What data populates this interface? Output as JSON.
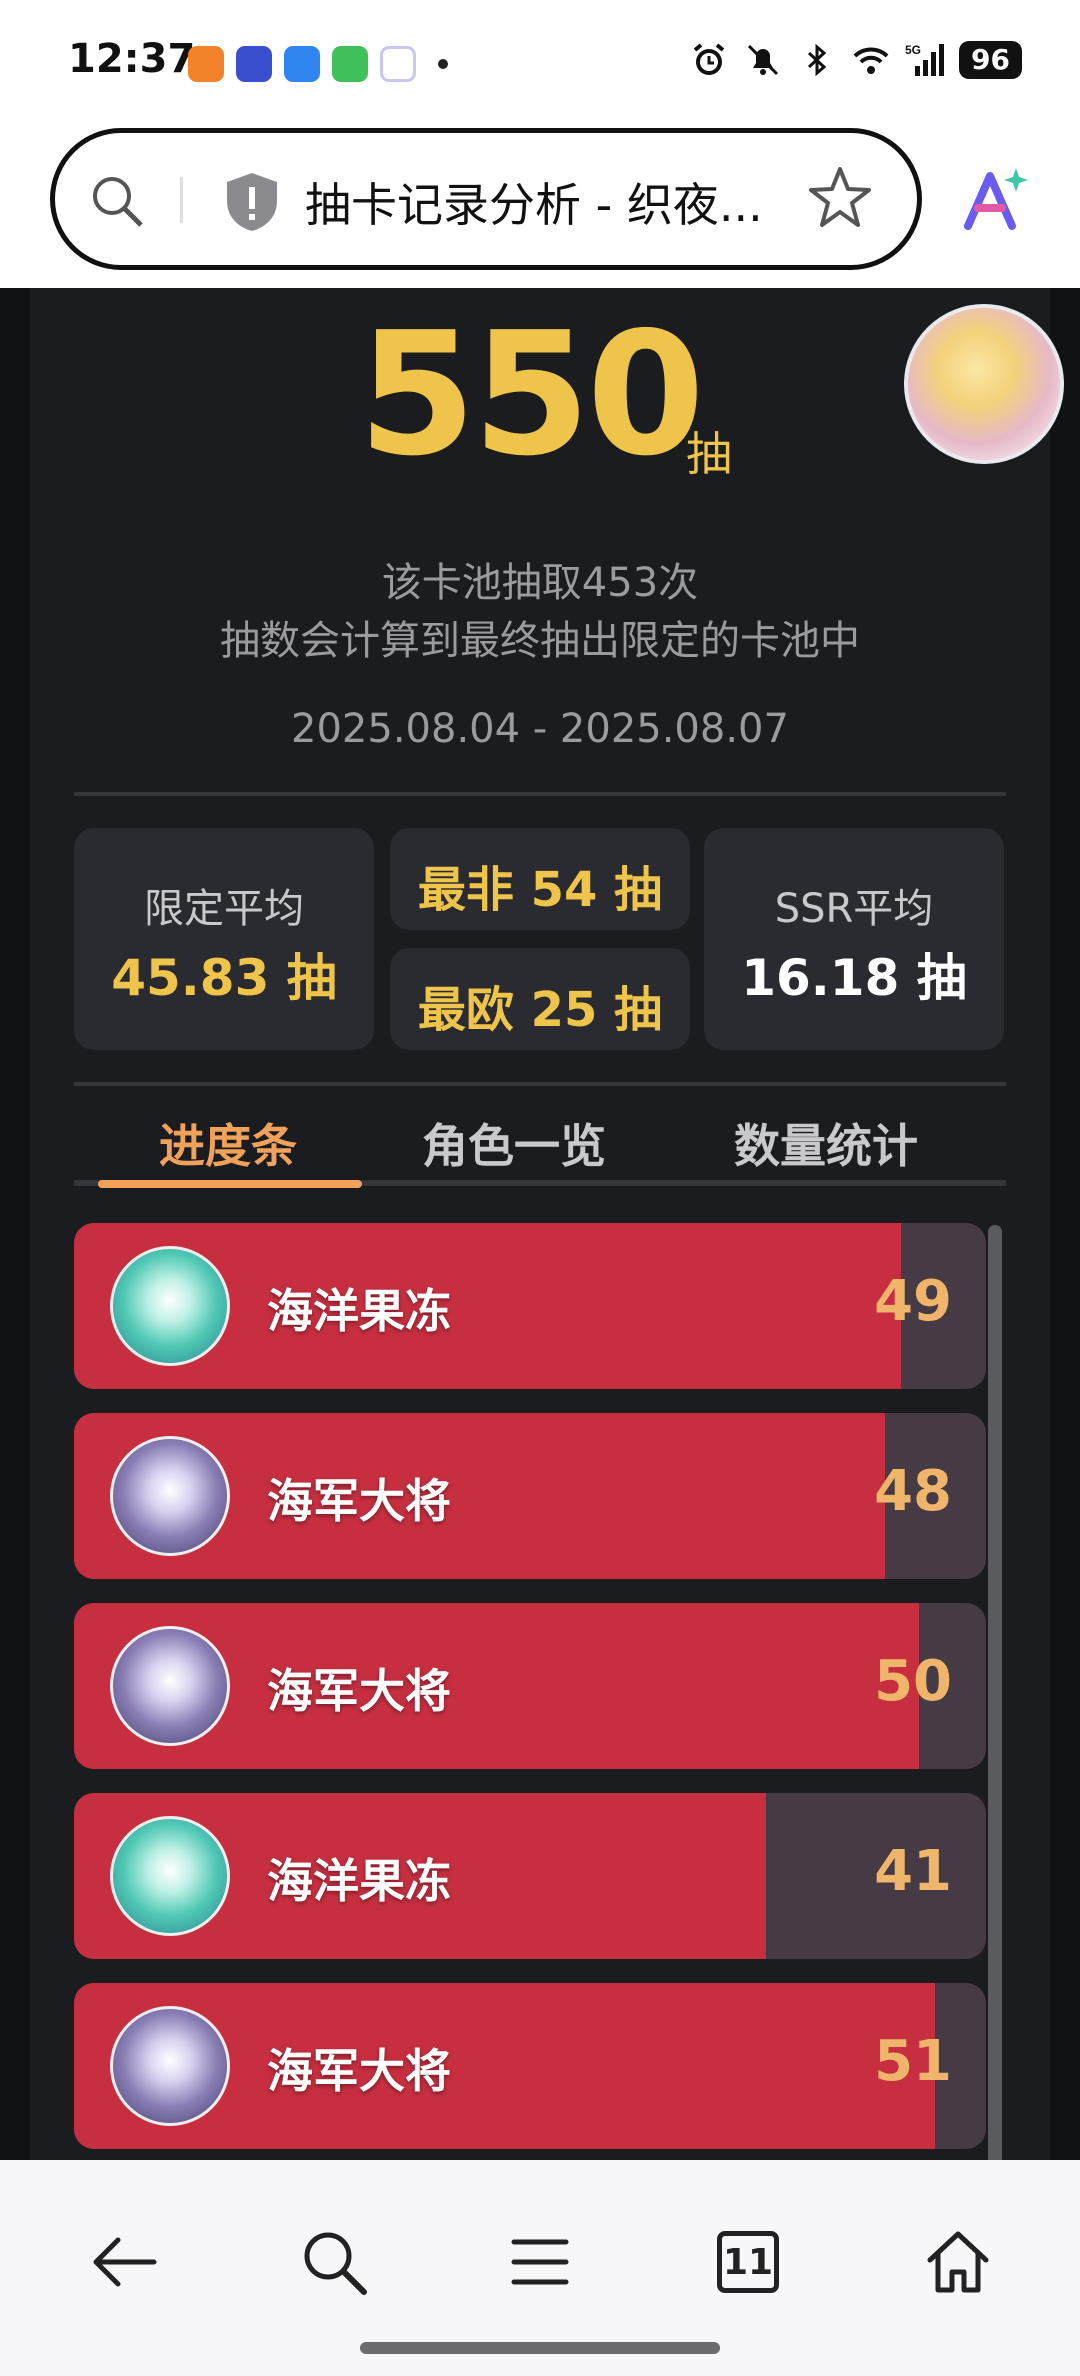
{
  "status_bar": {
    "time": "12:37",
    "battery": "96"
  },
  "browser": {
    "tab_title": "抽卡记录分析 - 织夜..."
  },
  "summary": {
    "total_pulls": "550",
    "unit": "抽",
    "desc_line1": "该卡池抽取453次",
    "desc_line2": "抽数会计算到最终抽出限定的卡池中",
    "date_range": "2025.08.04 - 2025.08.07"
  },
  "stats": {
    "limited_avg_label": "限定平均",
    "limited_avg_value": "45.83 抽",
    "worst": "最非 54 抽",
    "best": "最欧 25 抽",
    "ssr_avg_label": "SSR平均",
    "ssr_avg_value": "16.18 抽"
  },
  "tabs": [
    {
      "label": "进度条",
      "active": true
    },
    {
      "label": "角色一览",
      "active": false
    },
    {
      "label": "数量统计",
      "active": false
    }
  ],
  "rows": [
    {
      "name": "海洋果冻",
      "count": "49",
      "progress": 0.907,
      "avatar": "green"
    },
    {
      "name": "海军大将",
      "count": "48",
      "progress": 0.889,
      "avatar": "purple"
    },
    {
      "name": "海军大将",
      "count": "50",
      "progress": 0.926,
      "avatar": "purple"
    },
    {
      "name": "海洋果冻",
      "count": "41",
      "progress": 0.759,
      "avatar": "green"
    },
    {
      "name": "海军大将",
      "count": "51",
      "progress": 0.944,
      "avatar": "purple"
    }
  ],
  "bottom_nav": {
    "tabs_count": "11"
  },
  "colors": {
    "accent": "#efc44a",
    "tab_active": "#f1a25a",
    "bar_fill": "#c72f40",
    "bar_bg": "#463a45",
    "panel": "#1b1c20"
  }
}
